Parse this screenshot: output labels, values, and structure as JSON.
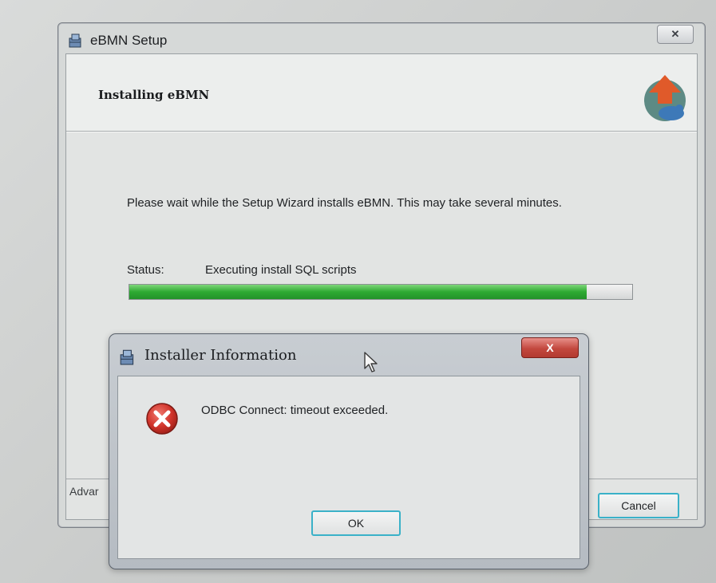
{
  "setup_window": {
    "title": "eBMN Setup",
    "close_label": "✕",
    "header_title": "Installing eBMN",
    "wait_text": "Please wait while the Setup Wizard installs eBMN.  This may take several minutes.",
    "status_label": "Status:",
    "status_value": "Executing install SQL scripts",
    "progress_percent": 91,
    "footer_label": "Advar",
    "cancel_label": "Cancel",
    "colors": {
      "progress": "#2eaa32",
      "focus_border": "#3ab1c8"
    }
  },
  "error_dialog": {
    "title": "Installer Information",
    "close_label": "X",
    "message": "ODBC Connect: timeout exceeded.",
    "ok_label": "OK",
    "icon": "error-icon",
    "colors": {
      "close_button": "#c3483e",
      "error_icon": "#d0332a"
    }
  }
}
